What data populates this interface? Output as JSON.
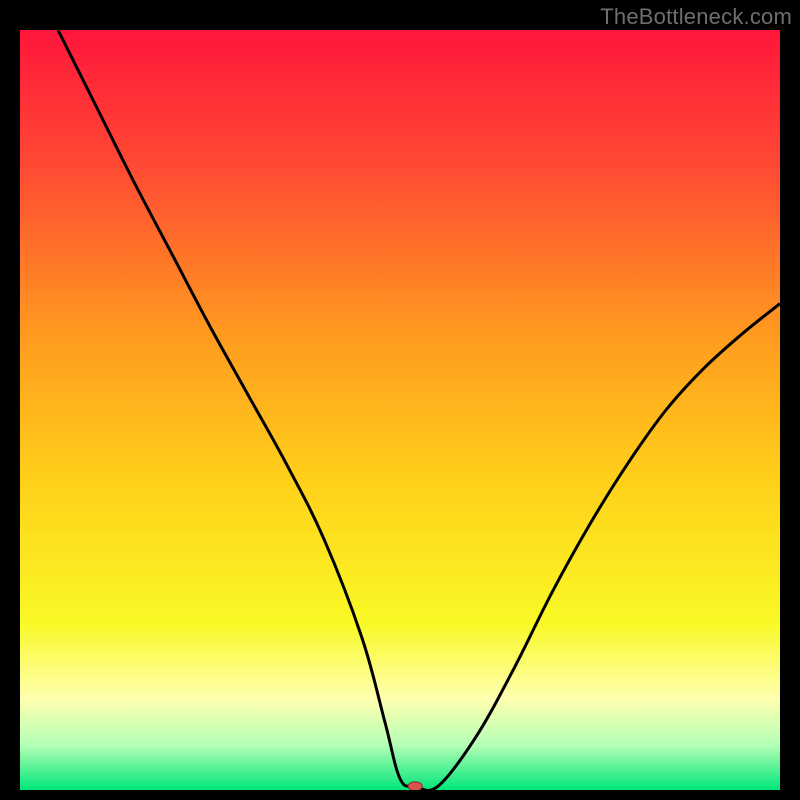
{
  "watermark": "TheBottleneck.com",
  "chart_data": {
    "type": "line",
    "title": "",
    "xlabel": "",
    "ylabel": "",
    "xlim": [
      0,
      100
    ],
    "ylim": [
      0,
      100
    ],
    "grid": false,
    "legend": false,
    "gradient_stops": [
      {
        "offset": 0.0,
        "color": "#ff163b"
      },
      {
        "offset": 0.18,
        "color": "#ff4a33"
      },
      {
        "offset": 0.4,
        "color": "#ff9a1f"
      },
      {
        "offset": 0.6,
        "color": "#ffd21a"
      },
      {
        "offset": 0.78,
        "color": "#f9f926"
      },
      {
        "offset": 0.88,
        "color": "#ffffb0"
      },
      {
        "offset": 0.94,
        "color": "#b6ffb6"
      },
      {
        "offset": 1.0,
        "color": "#00e67a"
      }
    ],
    "series": [
      {
        "name": "bottleneck-curve",
        "x": [
          5,
          10,
          15,
          20,
          25,
          30,
          35,
          40,
          45,
          48,
          50,
          52,
          55,
          60,
          65,
          70,
          75,
          80,
          85,
          90,
          95,
          100
        ],
        "y": [
          100,
          90,
          80,
          70.5,
          61,
          52,
          43,
          33,
          20,
          9,
          1.5,
          0.5,
          0.5,
          7,
          16,
          26,
          35,
          43,
          50,
          55.5,
          60,
          64
        ]
      }
    ],
    "marker": {
      "name": "bottleneck-marker",
      "x": 52,
      "y": 0.5,
      "color": "#d9534f",
      "rx": 7,
      "ry": 4.5
    }
  }
}
